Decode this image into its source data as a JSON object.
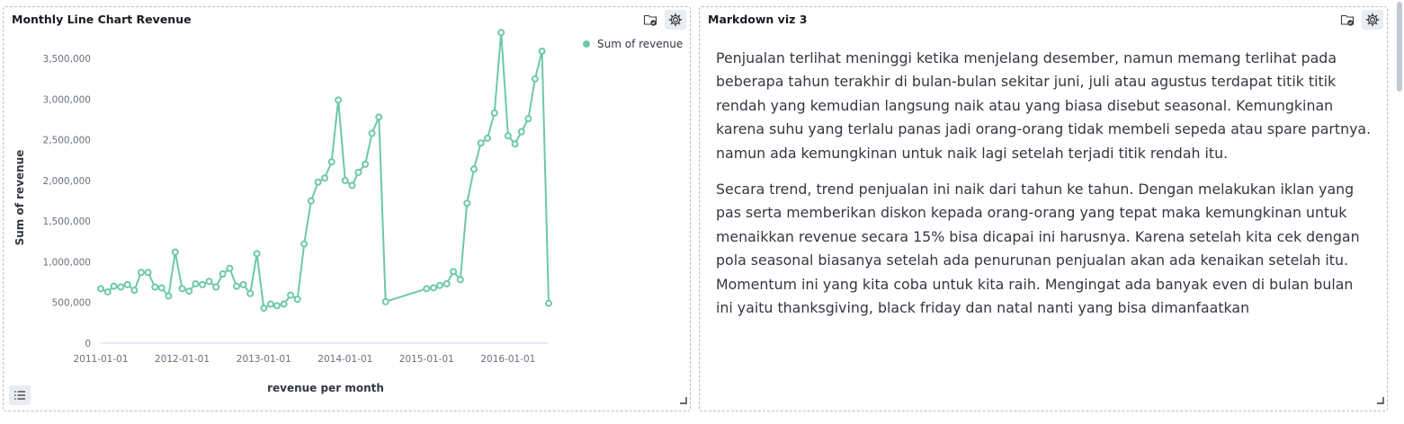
{
  "chart_panel": {
    "title": "Monthly Line Chart Revenue",
    "icons": [
      "folder-check-icon",
      "gear-icon"
    ]
  },
  "markdown_panel": {
    "title": "Markdown viz 3",
    "paragraphs": [
      "Penjualan terlihat meninggi ketika menjelang desember, namun memang terlihat pada beberapa tahun terakhir di bulan-bulan sekitar juni, juli atau agustus terdapat titik titik rendah yang kemudian langsung naik atau yang biasa disebut seasonal. Kemungkinan karena suhu yang terlalu panas jadi orang-orang tidak membeli sepeda atau spare partnya. namun ada kemungkinan untuk naik lagi setelah terjadi titik rendah itu.",
      "Secara trend, trend penjualan ini naik dari tahun ke tahun. Dengan melakukan iklan yang pas serta memberikan diskon kepada orang-orang yang tepat maka kemungkinan untuk menaikkan revenue secara 15% bisa dicapai ini harusnya. Karena setelah kita cek dengan pola seasonal biasanya setelah ada penurunan penjualan akan ada kenaikan setelah itu. Momentum ini yang kita coba untuk kita raih. Mengingat ada banyak even di bulan bulan ini yaitu thanksgiving, black friday dan natal nanti yang bisa dimanfaatkan"
    ]
  },
  "colors": {
    "series": "#6dc8a8",
    "axis_text": "#69707d",
    "title": "#1a1c21"
  },
  "chart_data": {
    "type": "line",
    "xlabel": "revenue per month",
    "ylabel": "Sum of revenue",
    "ylim": [
      0,
      3800000
    ],
    "xlim": [
      "2011-01-01",
      "2016-07-01"
    ],
    "yticks": [
      0,
      500000,
      1000000,
      1500000,
      2000000,
      2500000,
      3000000,
      3500000
    ],
    "ytick_labels": [
      "0",
      "500,000",
      "1,000,000",
      "1,500,000",
      "2,000,000",
      "2,500,000",
      "3,000,000",
      "3,500,000"
    ],
    "xticks": [
      "2011-01-01",
      "2012-01-01",
      "2013-01-01",
      "2014-01-01",
      "2015-01-01",
      "2016-01-01"
    ],
    "legend": "top-right",
    "grid": false,
    "series": [
      {
        "name": "Sum of revenue",
        "points": [
          [
            "2011-01-01",
            670000
          ],
          [
            "2011-02-01",
            630000
          ],
          [
            "2011-03-01",
            700000
          ],
          [
            "2011-04-01",
            690000
          ],
          [
            "2011-05-01",
            720000
          ],
          [
            "2011-06-01",
            650000
          ],
          [
            "2011-07-01",
            870000
          ],
          [
            "2011-08-01",
            870000
          ],
          [
            "2011-09-01",
            690000
          ],
          [
            "2011-10-01",
            680000
          ],
          [
            "2011-11-01",
            580000
          ],
          [
            "2011-12-01",
            1120000
          ],
          [
            "2012-01-01",
            670000
          ],
          [
            "2012-02-01",
            640000
          ],
          [
            "2012-03-01",
            730000
          ],
          [
            "2012-04-01",
            720000
          ],
          [
            "2012-05-01",
            760000
          ],
          [
            "2012-06-01",
            690000
          ],
          [
            "2012-07-01",
            850000
          ],
          [
            "2012-08-01",
            920000
          ],
          [
            "2012-09-01",
            700000
          ],
          [
            "2012-10-01",
            720000
          ],
          [
            "2012-11-01",
            610000
          ],
          [
            "2012-12-01",
            1100000
          ],
          [
            "2013-01-01",
            430000
          ],
          [
            "2013-02-01",
            480000
          ],
          [
            "2013-03-01",
            460000
          ],
          [
            "2013-04-01",
            480000
          ],
          [
            "2013-05-01",
            590000
          ],
          [
            "2013-06-01",
            540000
          ],
          [
            "2013-07-01",
            1220000
          ],
          [
            "2013-08-01",
            1750000
          ],
          [
            "2013-09-01",
            1980000
          ],
          [
            "2013-10-01",
            2030000
          ],
          [
            "2013-11-01",
            2230000
          ],
          [
            "2013-12-01",
            2990000
          ],
          [
            "2014-01-01",
            2000000
          ],
          [
            "2014-02-01",
            1940000
          ],
          [
            "2014-03-01",
            2100000
          ],
          [
            "2014-04-01",
            2200000
          ],
          [
            "2014-05-01",
            2580000
          ],
          [
            "2014-06-01",
            2780000
          ],
          [
            "2014-07-01",
            510000
          ],
          [
            "2015-01-01",
            670000
          ],
          [
            "2015-02-01",
            680000
          ],
          [
            "2015-03-01",
            710000
          ],
          [
            "2015-04-01",
            730000
          ],
          [
            "2015-05-01",
            880000
          ],
          [
            "2015-06-01",
            780000
          ],
          [
            "2015-07-01",
            1720000
          ],
          [
            "2015-08-01",
            2140000
          ],
          [
            "2015-09-01",
            2460000
          ],
          [
            "2015-10-01",
            2520000
          ],
          [
            "2015-11-01",
            2830000
          ],
          [
            "2015-12-01",
            3820000
          ],
          [
            "2016-01-01",
            2550000
          ],
          [
            "2016-02-01",
            2450000
          ],
          [
            "2016-03-01",
            2600000
          ],
          [
            "2016-04-01",
            2760000
          ],
          [
            "2016-05-01",
            3250000
          ],
          [
            "2016-06-01",
            3590000
          ],
          [
            "2016-07-01",
            490000
          ]
        ]
      }
    ]
  }
}
